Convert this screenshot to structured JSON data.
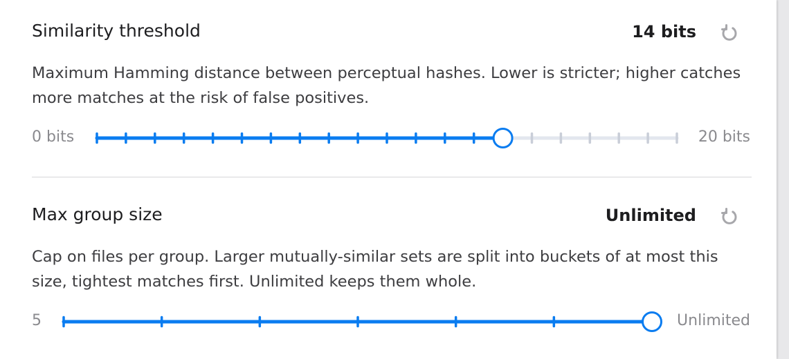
{
  "threshold": {
    "title": "Similarity threshold",
    "value_label": "14 bits",
    "description": "Maximum Hamming distance between perceptual hashes. Lower is stricter; higher catches more matches at the risk of false positives.",
    "min_label": "0 bits",
    "max_label": "20 bits",
    "min": 0,
    "max": 20,
    "value": 14,
    "steps": 20,
    "reset_icon": "reset-icon"
  },
  "group_size": {
    "title": "Max group size",
    "value_label": "Unlimited",
    "description": "Cap on files per group. Larger mutually-similar sets are split into buckets of at most this size, tightest matches first. Unlimited keeps them whole.",
    "min_label": "5",
    "max_label": "Unlimited",
    "steps": 6,
    "value_step": 6,
    "reset_icon": "reset-icon"
  },
  "colors": {
    "accent": "#0a7cf0",
    "track_inactive": "#e3e7ee",
    "tick_inactive": "#c9ced8"
  }
}
